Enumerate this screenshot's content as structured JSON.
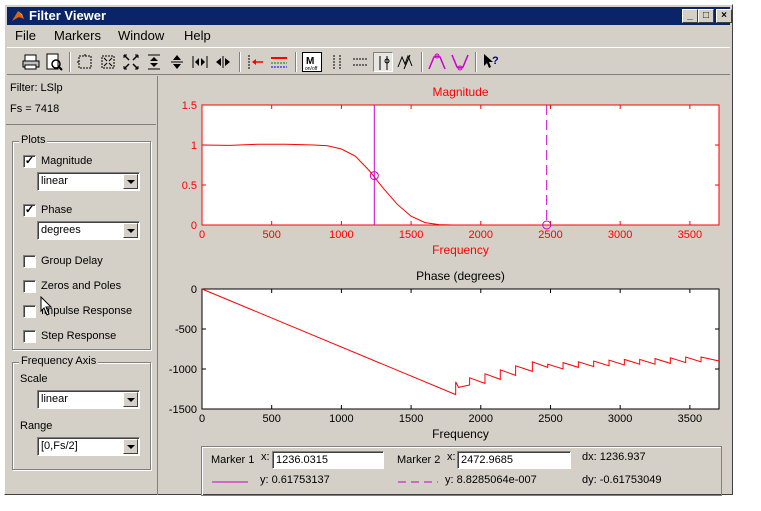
{
  "window": {
    "title": "Filter Viewer",
    "controls": [
      "_",
      "□",
      "×"
    ]
  },
  "menu": [
    "File",
    "Markers",
    "Window",
    "Help"
  ],
  "info": {
    "filter_label": "Filter: LSlp",
    "fs_label": "Fs = 7418"
  },
  "plots_group": {
    "title": "Plots",
    "magnitude": {
      "label": "Magnitude",
      "checked": true,
      "scale": "linear"
    },
    "phase": {
      "label": "Phase",
      "checked": true,
      "units": "degrees"
    },
    "group_delay": {
      "label": "Group Delay",
      "checked": false
    },
    "zeros_poles": {
      "label": "Zeros and Poles",
      "checked": false
    },
    "impulse": {
      "label": "Impulse Response",
      "checked": false
    },
    "step": {
      "label": "Step Response",
      "checked": false
    }
  },
  "freq_axis": {
    "title": "Frequency Axis",
    "scale_label": "Scale",
    "scale_value": "linear",
    "range_label": "Range",
    "range_value": "[0,Fs/2]"
  },
  "markers": {
    "marker1_label": "Marker 1",
    "marker1_x": "1236.0315",
    "marker1_y": "y: 0.61753137",
    "marker2_label": "Marker 2",
    "marker2_x": "2472.9685",
    "marker2_y": "y: 8.8285064e-007",
    "x_label": "x:",
    "dx": "dx: 1236.937",
    "dy": "dy: -0.61753049"
  },
  "chart_data": [
    {
      "type": "line",
      "title": "Magnitude",
      "xlabel": "Frequency",
      "ylabel": "",
      "xlim": [
        0,
        3709
      ],
      "ylim": [
        0,
        1.5
      ],
      "xticks": [
        0,
        500,
        1000,
        1500,
        2000,
        2500,
        3000,
        3500
      ],
      "yticks": [
        0,
        0.5,
        1,
        1.5
      ],
      "color": "#ff0000",
      "series": [
        {
          "x": [
            0,
            200,
            400,
            600,
            800,
            900,
            1000,
            1100,
            1200,
            1300,
            1400,
            1500,
            1600,
            1700,
            1800,
            2000,
            2500,
            3000,
            3709
          ],
          "y": [
            1.0,
            0.995,
            1.01,
            1.01,
            1.0,
            0.99,
            0.95,
            0.86,
            0.68,
            0.46,
            0.26,
            0.11,
            0.03,
            0.005,
            0.0,
            0.0,
            0.0,
            0.0,
            0.0
          ]
        }
      ],
      "markers": [
        {
          "x": 1236.0315,
          "y": 0.61753137,
          "style": "solid",
          "color": "#cc00cc"
        },
        {
          "x": 2472.9685,
          "y": 0.0,
          "style": "dashed",
          "color": "#cc00cc"
        }
      ]
    },
    {
      "type": "line",
      "title": "Phase (degrees)",
      "xlabel": "Frequency",
      "ylabel": "",
      "xlim": [
        0,
        3709
      ],
      "ylim": [
        -1500,
        0
      ],
      "xticks": [
        0,
        500,
        1000,
        1500,
        2000,
        2500,
        3000,
        3500
      ],
      "yticks": [
        0,
        -500,
        -1000,
        -1500
      ],
      "color": "#ff0000",
      "series": [
        {
          "x": [
            0,
            1820,
            1820,
            1840,
            1920,
            1920,
            2030,
            2030,
            2140,
            2140,
            2250,
            2250,
            2370,
            2370,
            2480,
            2480,
            2590,
            2590,
            2700,
            2700,
            2810,
            2810,
            2920,
            2920,
            3030,
            3030,
            3140,
            3140,
            3250,
            3250,
            3360,
            3360,
            3470,
            3470,
            3580,
            3580,
            3709
          ],
          "y": [
            0,
            -1320,
            -1160,
            -1230,
            -1200,
            -1110,
            -1180,
            -1060,
            -1130,
            -1010,
            -1080,
            -960,
            -1030,
            -910,
            -980,
            -940,
            -1000,
            -920,
            -980,
            -910,
            -970,
            -900,
            -960,
            -890,
            -950,
            -880,
            -940,
            -880,
            -940,
            -870,
            -930,
            -860,
            -920,
            -850,
            -910,
            -850,
            -900
          ]
        }
      ]
    }
  ]
}
